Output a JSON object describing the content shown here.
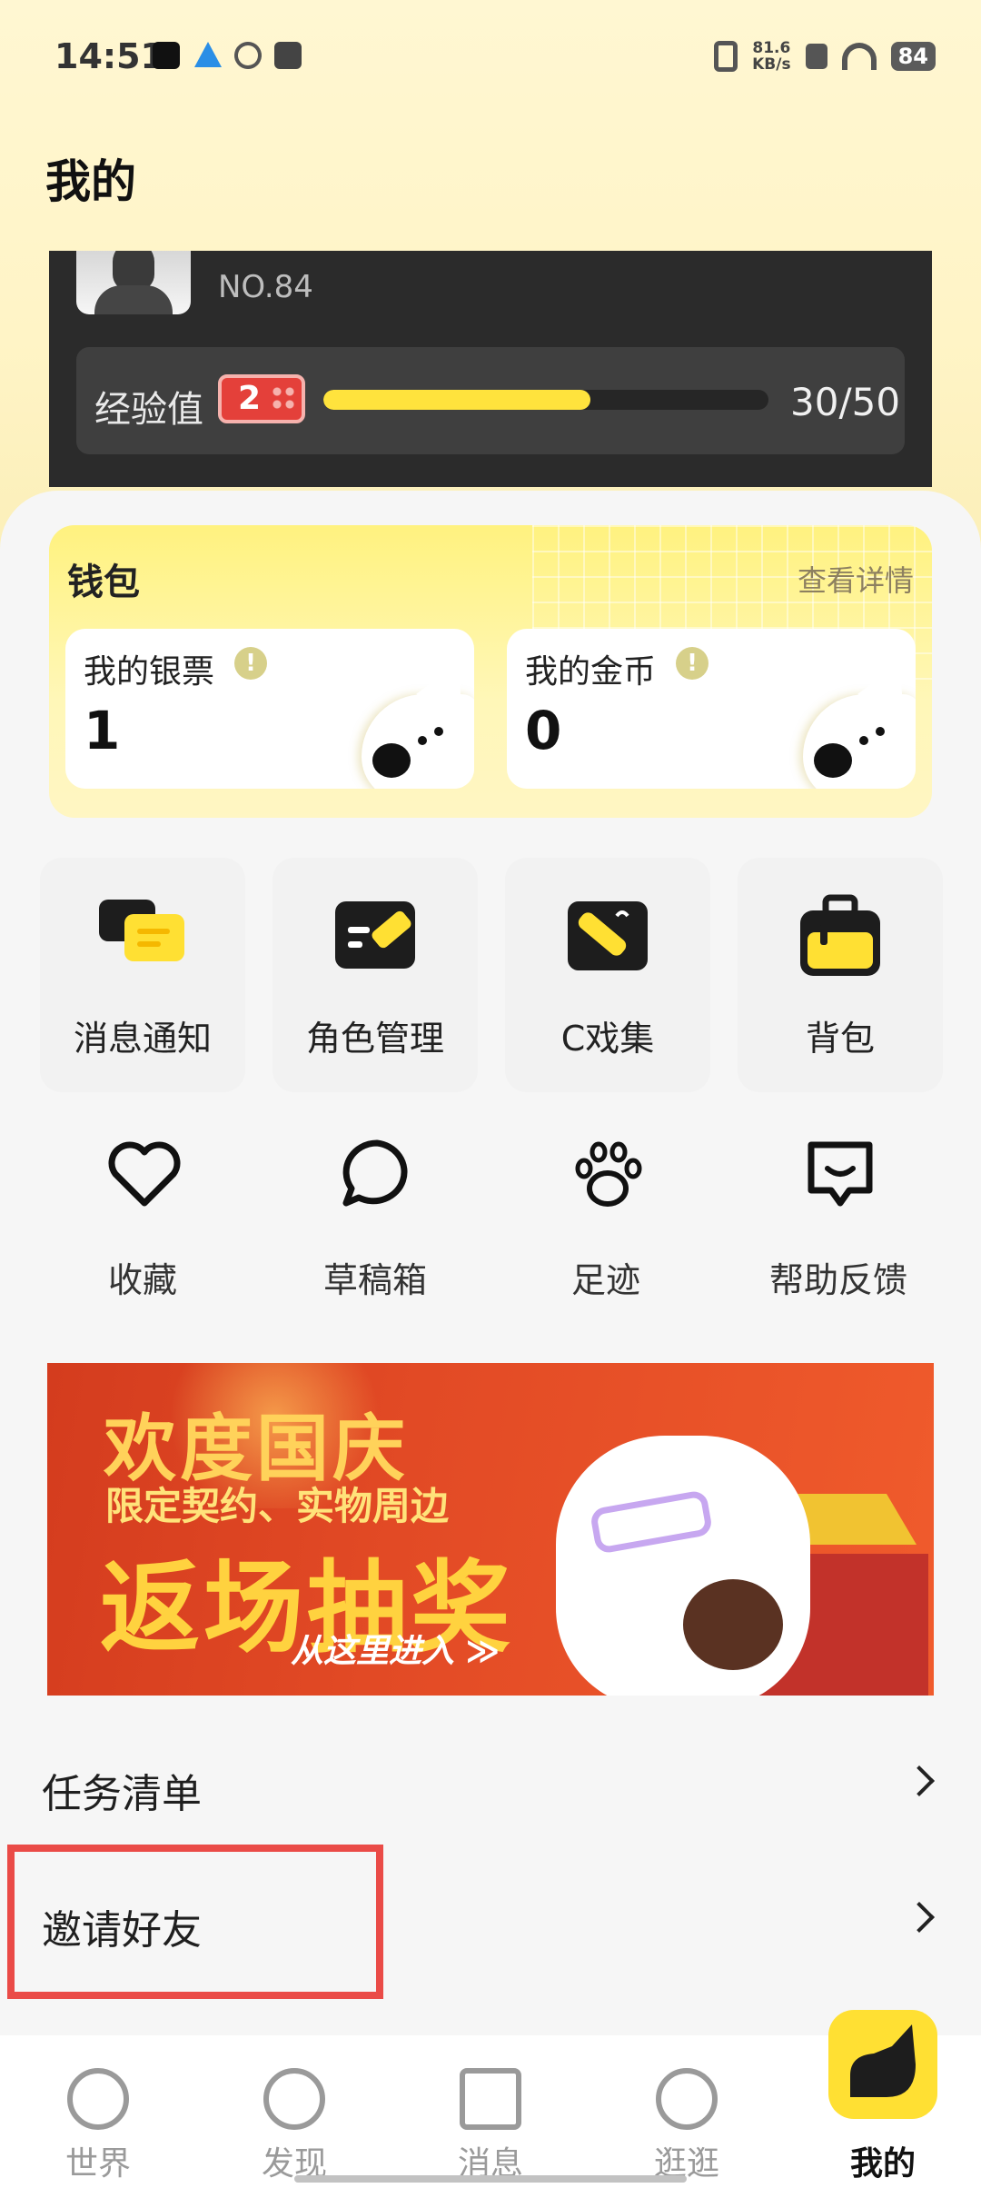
{
  "status_bar": {
    "time": "14:51",
    "net_speed_value": "81.6",
    "net_speed_unit": "KB/s",
    "battery": "84"
  },
  "page": {
    "title": "我的"
  },
  "profile": {
    "number": "NO.84",
    "exp_label": "经验值",
    "level": "2",
    "exp_current": 30,
    "exp_max": 50,
    "exp_text": "30/50",
    "exp_fill_fraction": 0.6
  },
  "wallet": {
    "title": "钱包",
    "detail_link": "查看详情",
    "silver": {
      "label": "我的银票",
      "value": "1"
    },
    "gold": {
      "label": "我的金币",
      "value": "0"
    }
  },
  "features": [
    {
      "label": "消息通知",
      "icon": "message-icon"
    },
    {
      "label": "角色管理",
      "icon": "edit-icon"
    },
    {
      "label": "C戏集",
      "icon": "drama-icon"
    },
    {
      "label": "背包",
      "icon": "bag-icon"
    }
  ],
  "tools": [
    {
      "label": "收藏",
      "icon": "heart-icon"
    },
    {
      "label": "草稿箱",
      "icon": "chat-bubble-icon"
    },
    {
      "label": "足迹",
      "icon": "paw-icon"
    },
    {
      "label": "帮助反馈",
      "icon": "feedback-icon"
    }
  ],
  "banner": {
    "line1": "欢度国庆",
    "line2": "限定契约、实物周边",
    "line3": "返场抽奖",
    "line4": "从这里进入 ≫"
  },
  "list": {
    "tasks": "任务清单",
    "invite": "邀请好友"
  },
  "nav": [
    {
      "label": "世界",
      "icon": "planet-icon"
    },
    {
      "label": "发现",
      "icon": "discover-icon"
    },
    {
      "label": "消息",
      "icon": "megaphone-icon"
    },
    {
      "label": "逛逛",
      "icon": "eye-icon"
    },
    {
      "label": "我的",
      "icon": "profile-icon",
      "active": true
    }
  ],
  "colors": {
    "accent_yellow": "#ffe033",
    "highlight_red": "#ea4b47",
    "profile_dark": "#2b2b2b"
  }
}
